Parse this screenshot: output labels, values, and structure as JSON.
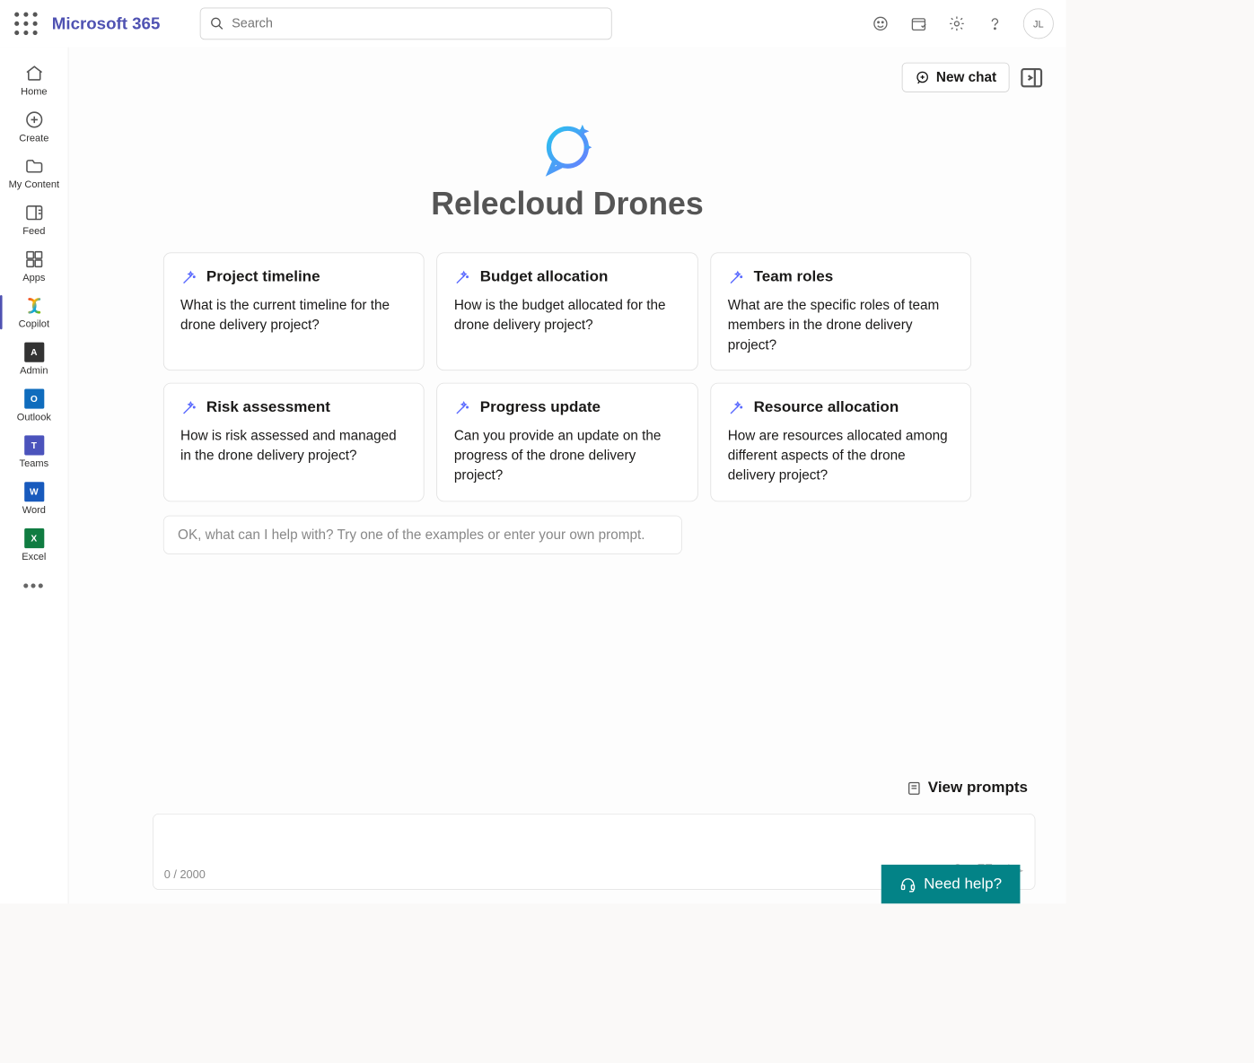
{
  "header": {
    "brand": "Microsoft 365",
    "search_placeholder": "Search",
    "avatar_initials": "JL"
  },
  "rail": {
    "items": [
      {
        "label": "Home"
      },
      {
        "label": "Create"
      },
      {
        "label": "My Content"
      },
      {
        "label": "Feed"
      },
      {
        "label": "Apps"
      },
      {
        "label": "Copilot"
      },
      {
        "label": "Admin"
      },
      {
        "label": "Outlook"
      },
      {
        "label": "Teams"
      },
      {
        "label": "Word"
      },
      {
        "label": "Excel"
      }
    ]
  },
  "topbar": {
    "new_chat": "New chat"
  },
  "hero": {
    "title": "Relecloud Drones"
  },
  "cards": [
    {
      "title": "Project timeline",
      "body": "What is the current timeline for the drone delivery project?"
    },
    {
      "title": "Budget allocation",
      "body": "How is the budget allocated for the drone delivery project?"
    },
    {
      "title": "Team roles",
      "body": "What are the specific roles of team members in the drone delivery project?"
    },
    {
      "title": "Risk assessment",
      "body": "How is risk assessed and managed in the drone delivery project?"
    },
    {
      "title": "Progress update",
      "body": "Can you provide an update on the progress of the drone delivery project?"
    },
    {
      "title": "Resource allocation",
      "body": "How are resources allocated among different aspects of the drone delivery project?"
    }
  ],
  "msgbar": {
    "placeholder": "OK, what can I help with? Try one of the examples or enter your own prompt."
  },
  "view_prompts": "View prompts",
  "composer": {
    "counter": "0 / 2000"
  },
  "need_help": "Need help?"
}
